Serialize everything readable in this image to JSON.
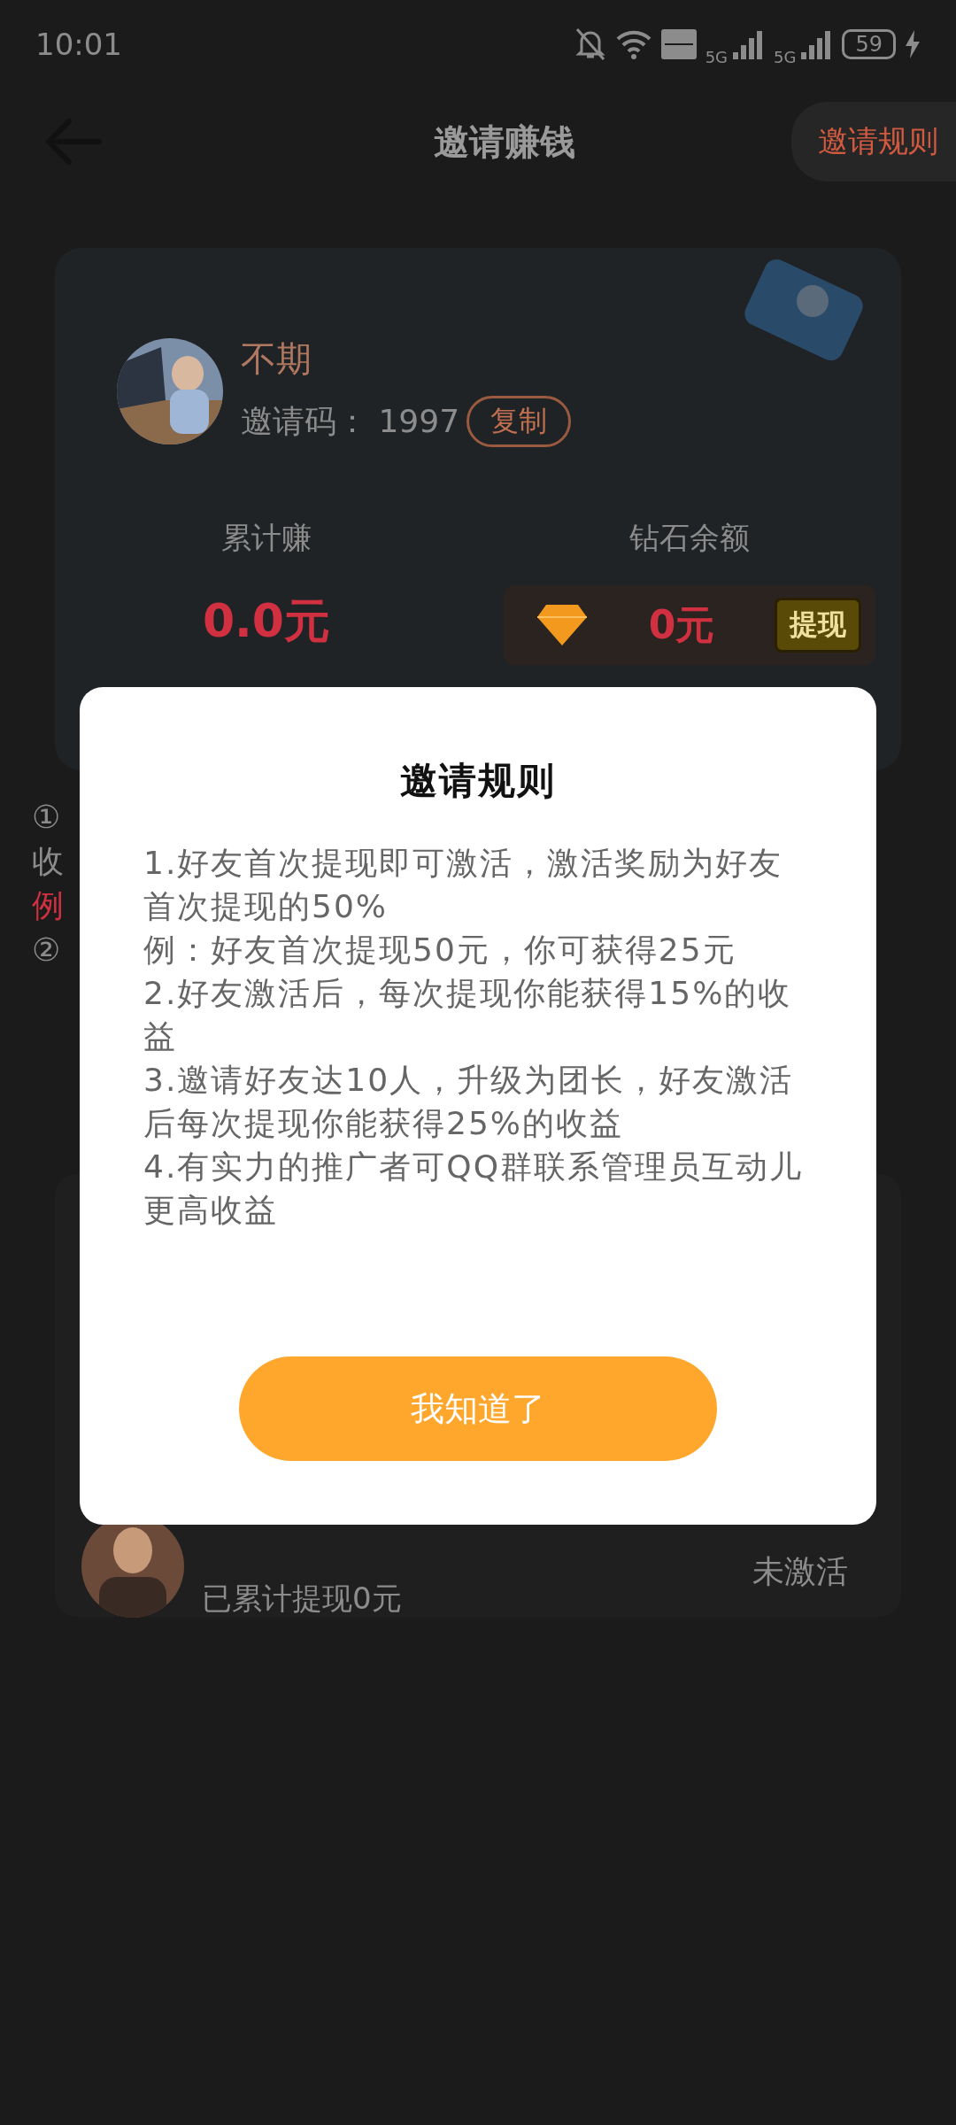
{
  "status_bar": {
    "time": "10:01",
    "network_labels": [
      "5G",
      "5G"
    ],
    "battery": "59"
  },
  "header": {
    "title": "邀请赚钱",
    "rules_link": "邀请规则"
  },
  "profile": {
    "name": "不期",
    "invite_label": "邀请码：",
    "invite_code": "1997",
    "copy_button": "复制"
  },
  "stats": [
    {
      "kind": "plain",
      "label": "累计赚",
      "value": "0.0元"
    },
    {
      "kind": "diamond",
      "label": "钻石余额",
      "value": "0元",
      "action": "提现"
    }
  ],
  "notes": [
    {
      "kind": "plain",
      "text": "①"
    },
    {
      "kind": "plain",
      "text": "收"
    },
    {
      "kind": "highlight",
      "text": "例"
    },
    {
      "kind": "plain",
      "text": "②"
    }
  ],
  "friends": [
    {
      "status": "未激活",
      "withdrawn": "已累计提现0元"
    }
  ],
  "dialog": {
    "title": "邀请规则",
    "rules": [
      "1.好友首次提现即可激活，激活奖励为好友首次提现的50%",
      "例：好友首次提现50元，你可获得25元",
      "2.好友激活后，每次提现你能获得15%的收益",
      "3.邀请好友达10人，升级为团长，好友激活后每次提现你能获得25%的收益",
      "4.有实力的推广者可QQ群联系管理员互动儿更高收益"
    ],
    "confirm": "我知道了"
  }
}
